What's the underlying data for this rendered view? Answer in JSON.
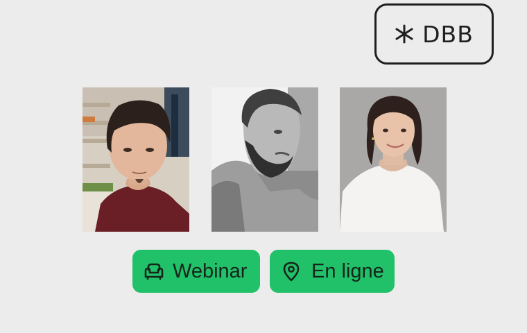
{
  "brand": {
    "logo_text": "DBB",
    "logo_icon": "asterisk-icon",
    "color": "#1f1f1f"
  },
  "speakers": [
    {
      "icon": "portrait-photo",
      "tone": "color"
    },
    {
      "icon": "portrait-photo",
      "tone": "black-and-white"
    },
    {
      "icon": "portrait-photo",
      "tone": "color"
    }
  ],
  "tags": {
    "webinar": {
      "label": "Webinar",
      "icon": "armchair-icon"
    },
    "location": {
      "label": "En ligne",
      "icon": "map-pin-icon"
    }
  },
  "colors": {
    "background": "#ececec",
    "tag_background": "#20c169",
    "tag_text": "#16241b"
  }
}
